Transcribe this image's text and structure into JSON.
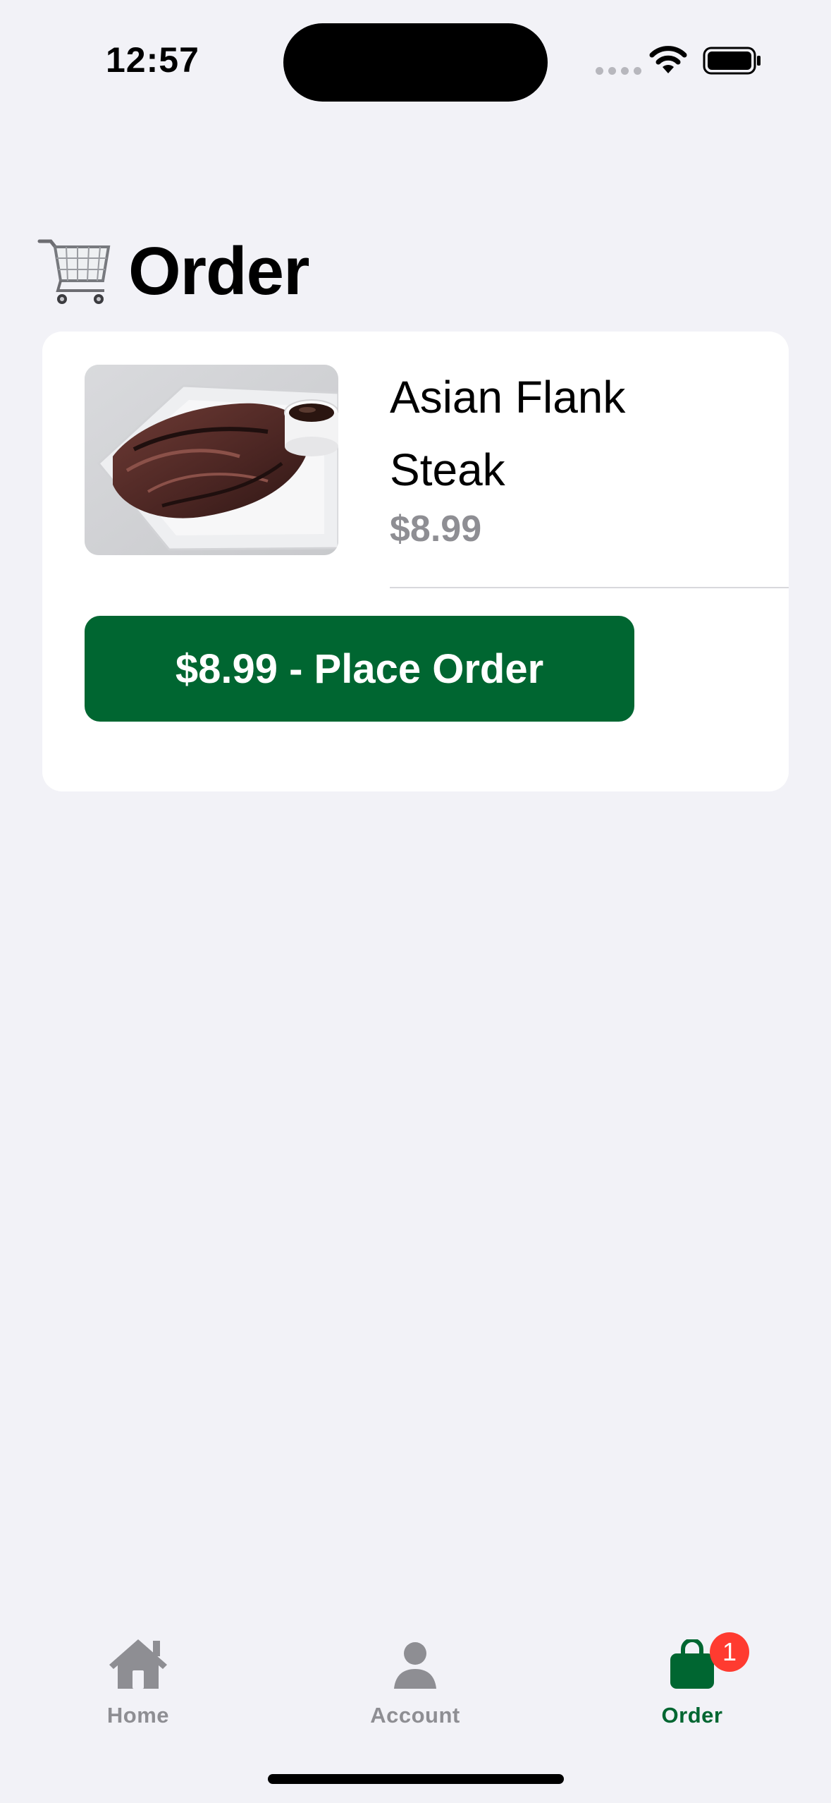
{
  "status_bar": {
    "time": "12:57"
  },
  "header": {
    "title": "Order"
  },
  "cart": {
    "items": [
      {
        "name": "Asian Flank Steak",
        "price": "$8.99",
        "image": "grilled-flank-steak-photo"
      }
    ],
    "place_order_label": "$8.99 - Place Order"
  },
  "tab_bar": {
    "tabs": [
      {
        "label": "Home",
        "icon": "home-icon"
      },
      {
        "label": "Account",
        "icon": "person-icon"
      },
      {
        "label": "Order",
        "icon": "shopping-bag-icon",
        "badge": "1",
        "active": true
      }
    ]
  },
  "colors": {
    "accent": "#006631",
    "background": "#f2f2f7",
    "inactive_tab": "#8e8e93",
    "badge": "#ff3b30"
  }
}
